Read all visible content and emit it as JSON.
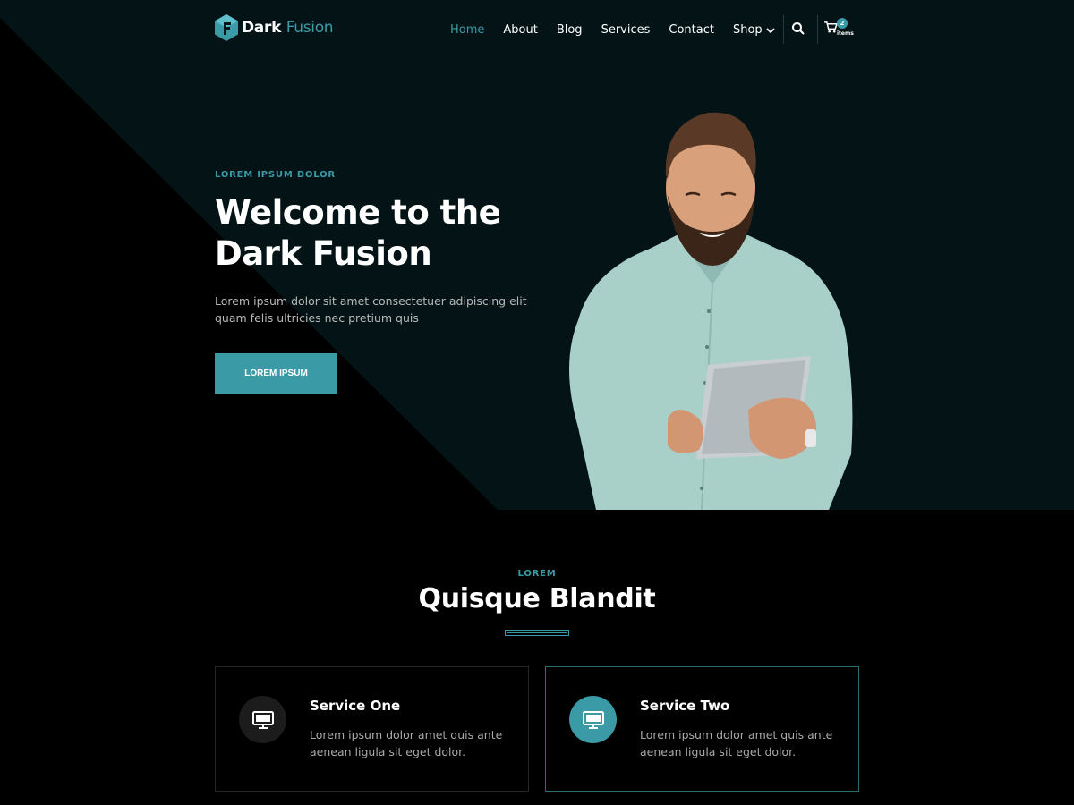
{
  "colors": {
    "accent": "#3a9aa6",
    "hero_panel": "#041416",
    "background": "#000000"
  },
  "brand": {
    "name_part1": "Dark",
    "name_part2": "Fusion"
  },
  "nav": {
    "items": [
      {
        "label": "Home",
        "active": true
      },
      {
        "label": "About"
      },
      {
        "label": "Blog"
      },
      {
        "label": "Services"
      },
      {
        "label": "Contact"
      },
      {
        "label": "Shop",
        "has_dropdown": true
      }
    ],
    "cart": {
      "count": "2",
      "label": "items"
    },
    "icons": {
      "search": "search-icon",
      "cart": "cart-icon",
      "dropdown": "chevron-down-icon"
    }
  },
  "hero": {
    "eyebrow": "LOREM IPSUM DOLOR",
    "title_line1": "Welcome to the",
    "title_line2": "Dark Fusion",
    "description": "Lorem ipsum dolor sit amet consectetuer adipiscing elit quam felis ultricies nec pretium quis",
    "button_label": "LOREM IPSUM"
  },
  "services": {
    "eyebrow": "LOREM",
    "title": "Quisque Blandit",
    "cards": [
      {
        "title": "Service One",
        "description": "Lorem ipsum dolor amet quis ante aenean ligula sit eget dolor.",
        "icon": "monitor-icon"
      },
      {
        "title": "Service Two",
        "description": "Lorem ipsum dolor amet quis ante aenean ligula sit eget dolor.",
        "icon": "monitor-icon"
      }
    ]
  }
}
